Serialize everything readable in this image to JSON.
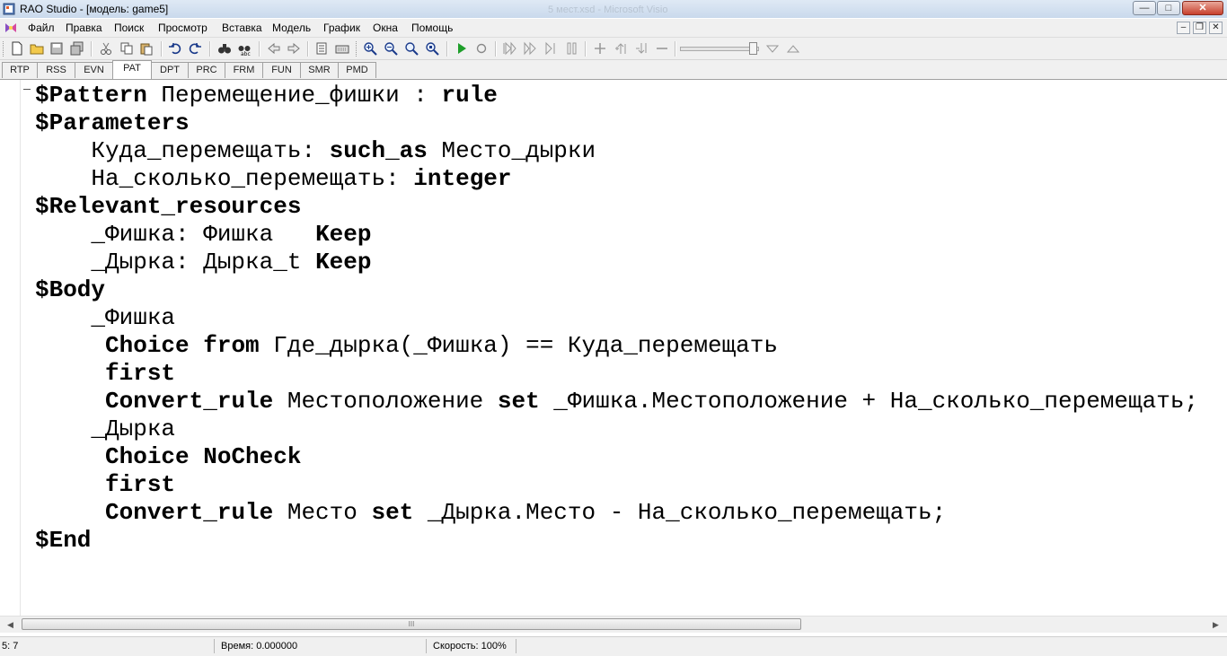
{
  "window": {
    "title": "RAO Studio - [модель: game5]",
    "background_title": "5 мест.xsd - Microsoft Visio",
    "controls": {
      "minimize": "—",
      "maximize": "□",
      "close": "✕"
    }
  },
  "menubar": {
    "items": [
      "Файл",
      "Правка",
      "Поиск",
      "Просмотр",
      "Вставка",
      "Модель",
      "График",
      "Окна",
      "Помощь"
    ],
    "mdi_controls": {
      "minimize": "–",
      "restore": "❐",
      "close": "✕"
    }
  },
  "toolbar": {
    "icons": [
      "new-file-icon",
      "open-folder-icon",
      "save-icon",
      "save-all-icon",
      "cut-icon",
      "copy-icon",
      "paste-icon",
      "undo-icon",
      "redo-icon",
      "find-icon",
      "replace-icon",
      "back-icon",
      "forward-icon",
      "bookmark-icon",
      "keyboard-icon",
      "zoom-in-icon",
      "zoom-out-icon",
      "zoom-fit-icon",
      "zoom-reset-icon",
      "run-icon",
      "stop-icon",
      "step-first-icon",
      "step-speed-icon",
      "step-next-icon",
      "pause-icon",
      "add-icon",
      "step-up-icon",
      "step-down-icon",
      "remove-icon",
      "speed-down-icon",
      "speed-up-icon"
    ],
    "accent_run": "#1e9e2a",
    "slider_level": 0.94
  },
  "tabs": {
    "items": [
      "RTP",
      "RSS",
      "EVN",
      "PAT",
      "DPT",
      "PRC",
      "FRM",
      "FUN",
      "SMR",
      "PMD"
    ],
    "active": "PAT"
  },
  "editor": {
    "lines": [
      [
        {
          "t": "$Pattern",
          "b": true
        },
        {
          "t": " Перемещение_фишки : "
        },
        {
          "t": "rule",
          "b": true
        }
      ],
      [
        {
          "t": "$Parameters",
          "b": true
        }
      ],
      [
        {
          "t": "    Куда_перемещать: "
        },
        {
          "t": "such_as",
          "b": true
        },
        {
          "t": " Место_дырки"
        }
      ],
      [
        {
          "t": "    На_сколько_перемещать: "
        },
        {
          "t": "integer",
          "b": true
        }
      ],
      [
        {
          "t": "$Relevant_resources",
          "b": true
        }
      ],
      [
        {
          "t": "    _Фишка: Фишка   "
        },
        {
          "t": "Keep",
          "b": true
        }
      ],
      [
        {
          "t": "    _Дырка: Дырка_t "
        },
        {
          "t": "Keep",
          "b": true
        }
      ],
      [
        {
          "t": "$Body",
          "b": true
        }
      ],
      [
        {
          "t": "    _Фишка"
        }
      ],
      [
        {
          "t": "     "
        },
        {
          "t": "Choice from",
          "b": true
        },
        {
          "t": " Где_дырка(_Фишка) == Куда_перемещать"
        }
      ],
      [
        {
          "t": "     "
        },
        {
          "t": "first",
          "b": true
        }
      ],
      [
        {
          "t": "     "
        },
        {
          "t": "Convert_rule",
          "b": true
        },
        {
          "t": " Местоположение "
        },
        {
          "t": "set",
          "b": true
        },
        {
          "t": " _Фишка.Местоположение + На_сколько_перемещать;"
        }
      ],
      [
        {
          "t": "    _Дырка"
        }
      ],
      [
        {
          "t": "     "
        },
        {
          "t": "Choice NoCheck",
          "b": true
        }
      ],
      [
        {
          "t": "     "
        },
        {
          "t": "first",
          "b": true
        }
      ],
      [
        {
          "t": "     "
        },
        {
          "t": "Convert_rule",
          "b": true
        },
        {
          "t": " Место "
        },
        {
          "t": "set",
          "b": true
        },
        {
          "t": " _Дырка.Место - На_сколько_перемещать;"
        }
      ],
      [
        {
          "t": "$End",
          "b": true
        }
      ]
    ]
  },
  "scrollbar": {
    "left_arrow": "◀",
    "right_arrow": "▶",
    "thumb_grip": "III"
  },
  "statusbar": {
    "position": "5: 7",
    "time": "Время: 0.000000",
    "speed": "Скорость: 100%"
  }
}
